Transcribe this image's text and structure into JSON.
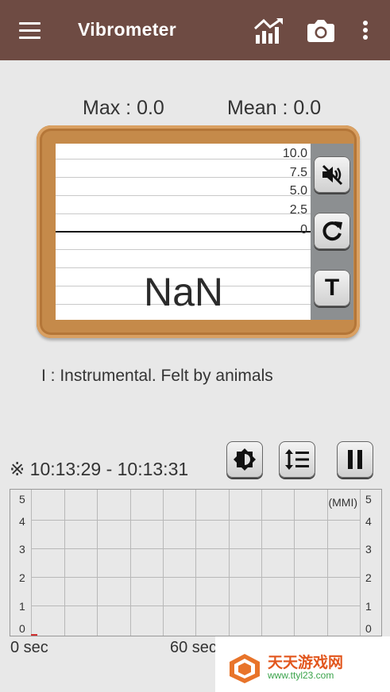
{
  "appbar": {
    "title": "Vibrometer",
    "icons": [
      "menu-icon",
      "chart-icon",
      "camera-icon",
      "more-vert-icon"
    ],
    "background": "#6e4b43"
  },
  "stats": {
    "max_label": "Max : 0.0",
    "mean_label": "Mean : 0.0"
  },
  "gauge": {
    "scale_labels": [
      "10.0",
      "7.5",
      "5.0",
      "2.5",
      "0"
    ],
    "current_value": "NaN",
    "buttons": [
      "mute-icon",
      "refresh-icon",
      "T"
    ],
    "frame_color": "#c58a4a"
  },
  "intensity": {
    "text": "I   : Instrumental. Felt by animals"
  },
  "controls": {
    "time_range": "※ 10:13:29 - 10:13:31",
    "buttons": [
      "brightness-icon",
      "line-spacing-icon",
      "pause-icon"
    ]
  },
  "chart_data": {
    "type": "line",
    "title": "",
    "unit_label": "(MMI)",
    "y_ticks": [
      "5",
      "4",
      "3",
      "2",
      "1",
      "0"
    ],
    "ylim": [
      0,
      5
    ],
    "x_labels": [
      "0 sec",
      "60 sec"
    ],
    "grid": true,
    "series": [
      {
        "values": []
      }
    ]
  },
  "watermark": {
    "line1": "天天游戏网",
    "line2": "www.ttyl23.com"
  }
}
